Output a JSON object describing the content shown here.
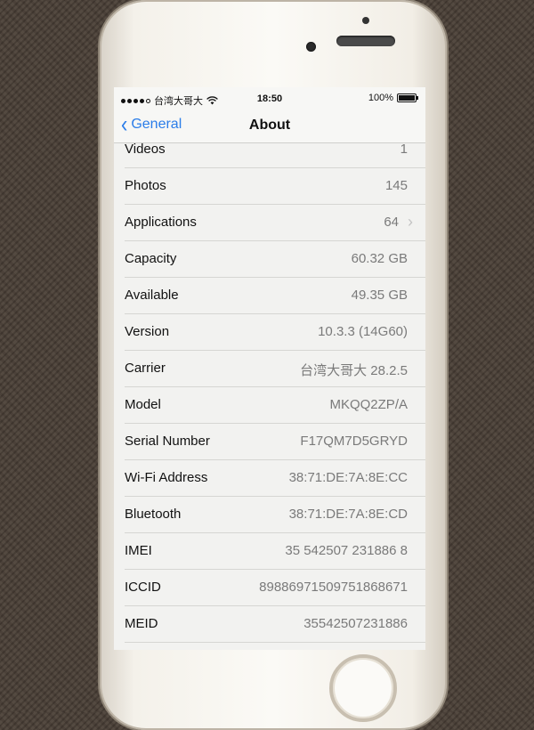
{
  "status_bar": {
    "carrier": "台湾大哥大",
    "time": "18:50",
    "battery": "100%",
    "signal_bars": 4
  },
  "nav": {
    "back_label": "General",
    "title": "About"
  },
  "rows": [
    {
      "label": "Videos",
      "value": "1"
    },
    {
      "label": "Photos",
      "value": "145"
    },
    {
      "label": "Applications",
      "value": "64",
      "disclosure": true
    },
    {
      "label": "Capacity",
      "value": "60.32 GB"
    },
    {
      "label": "Available",
      "value": "49.35 GB"
    },
    {
      "label": "Version",
      "value": "10.3.3 (14G60)"
    },
    {
      "label": "Carrier",
      "value": "台湾大哥大 28.2.5"
    },
    {
      "label": "Model",
      "value": "MKQQ2ZP/A"
    },
    {
      "label": "Serial Number",
      "value": "F17QM7D5GRYD"
    },
    {
      "label": "Wi-Fi Address",
      "value": "38:71:DE:7A:8E:CC"
    },
    {
      "label": "Bluetooth",
      "value": "38:71:DE:7A:8E:CD"
    },
    {
      "label": "IMEI",
      "value": "35 542507 231886 8"
    },
    {
      "label": "ICCID",
      "value": "89886971509751868671"
    },
    {
      "label": "MEID",
      "value": "35542507231886"
    }
  ],
  "colors": {
    "accent": "#2b7de9",
    "value_text": "#7a7a7a"
  },
  "icons": [
    "wifi-icon",
    "battery-icon",
    "back-chevron-icon",
    "disclosure-chevron-icon"
  ]
}
